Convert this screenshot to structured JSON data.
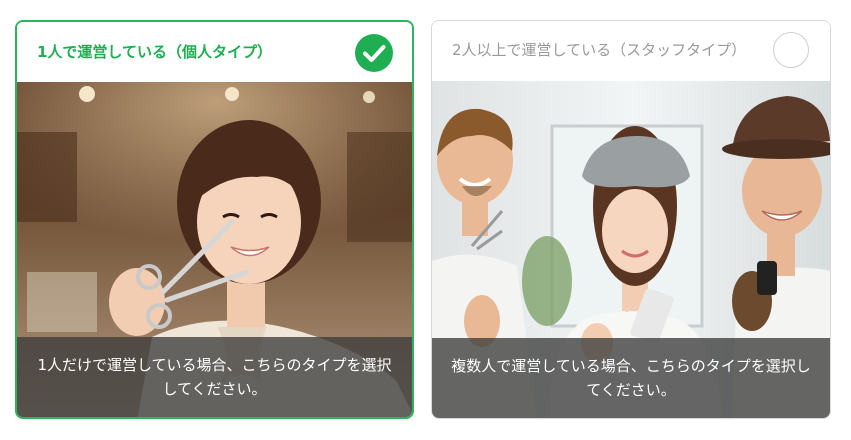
{
  "options": [
    {
      "title": "1人で運営している（個人タイプ）",
      "caption": "1人だけで運営している場合、こちらのタイプを選択してください。",
      "selected": true
    },
    {
      "title": "2人以上で運営している（スタッフタイプ）",
      "caption": "複数人で運営している場合、こちらのタイプを選択してください。",
      "selected": false
    }
  ],
  "colors": {
    "accent": "#2bb55f",
    "unselected_border": "#d9d9d9",
    "caption_overlay": "#3c3c3c"
  },
  "icons": {
    "selected": "check-circle-icon",
    "unselected": "radio-empty-icon"
  }
}
